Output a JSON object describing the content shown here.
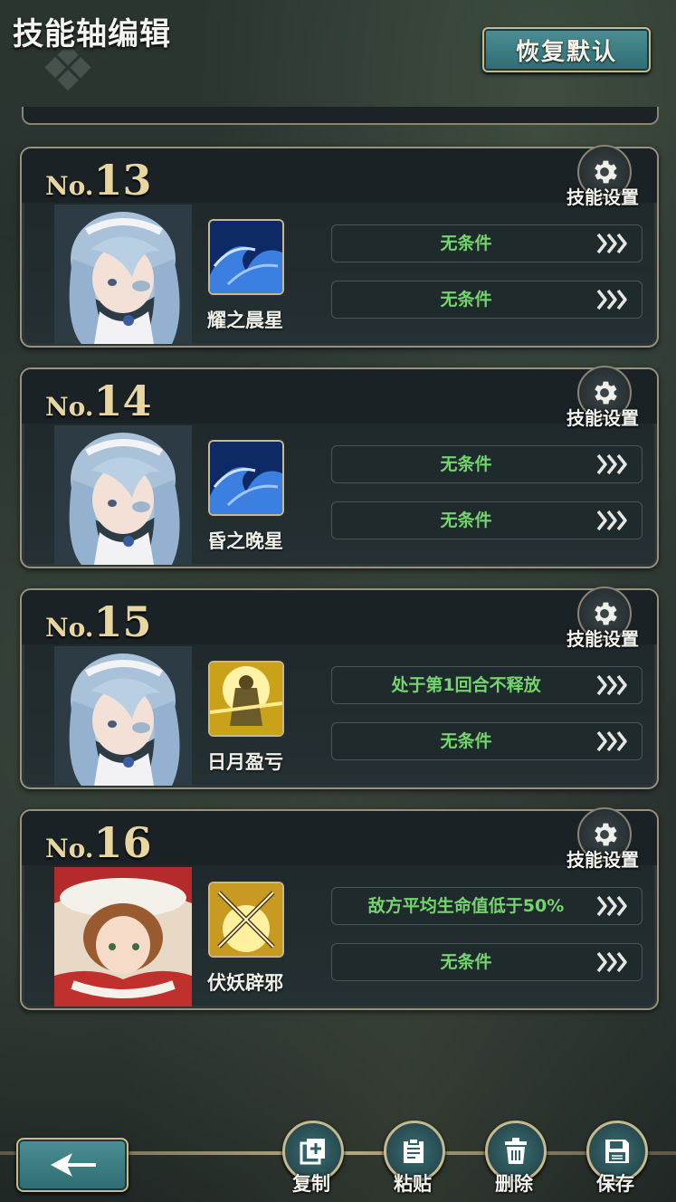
{
  "header": {
    "title": "技能轴编辑",
    "reset_label": "恢复默认"
  },
  "cards": [
    {
      "no_prefix": "No.",
      "no": "13",
      "gear_label": "技能设置",
      "skill_name": "耀之晨星",
      "skill_color": "blue",
      "conditions": [
        "无条件",
        "无条件"
      ]
    },
    {
      "no_prefix": "No.",
      "no": "14",
      "gear_label": "技能设置",
      "skill_name": "昏之晚星",
      "skill_color": "blue",
      "conditions": [
        "无条件",
        "无条件"
      ]
    },
    {
      "no_prefix": "No.",
      "no": "15",
      "gear_label": "技能设置",
      "skill_name": "日月盈亏",
      "skill_color": "gold",
      "conditions": [
        "处于第1回合不释放",
        "无条件"
      ]
    },
    {
      "no_prefix": "No.",
      "no": "16",
      "gear_label": "技能设置",
      "skill_name": "伏妖辟邪",
      "skill_color": "gold",
      "conditions": [
        "敌方平均生命值低于50%",
        "无条件"
      ]
    }
  ],
  "footer": {
    "copy_label": "复制",
    "paste_label": "粘贴",
    "delete_label": "删除",
    "save_label": "保存"
  },
  "colors": {
    "condition_text": "#74d46d",
    "accent_gold": "#c9b98a",
    "button_teal": "#3d7e84"
  }
}
